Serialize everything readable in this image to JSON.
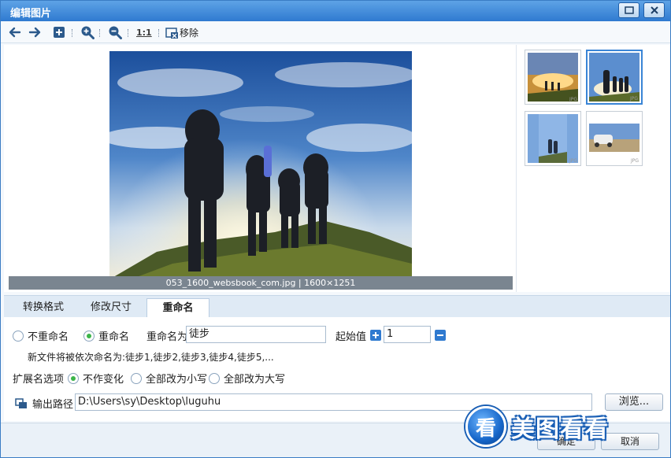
{
  "window": {
    "title": "编辑图片"
  },
  "toolbar": {
    "back_icon": "arrow-left-icon",
    "forward_icon": "arrow-right-icon",
    "add_icon": "plus-square-icon",
    "zoom_in_icon": "zoom-in-icon",
    "zoom_out_icon": "zoom-out-icon",
    "actual_size_label": "1:1",
    "remove_label": "移除"
  },
  "preview": {
    "caption": "053_1600_websbook_com.jpg | 1600×1251"
  },
  "thumbnails": [
    {
      "tag": "JPG",
      "selected": false
    },
    {
      "tag": "JPG",
      "selected": true
    },
    {
      "tag": "JPG",
      "selected": false
    },
    {
      "tag": "JPG",
      "selected": false
    }
  ],
  "tabs": [
    {
      "label": "转换格式",
      "active": false
    },
    {
      "label": "修改尺寸",
      "active": false
    },
    {
      "label": "重命名",
      "active": true
    }
  ],
  "rename": {
    "option_no_rename": "不重命名",
    "option_rename": "重命名",
    "rename_as_label": "重命名为",
    "rename_as_value": "徒步",
    "start_value_label": "起始值",
    "start_value": "1",
    "preview_text": "新文件将被依次命名为:徒步1,徒步2,徒步3,徒步4,徒步5,...",
    "ext_label": "扩展名选项",
    "ext_no_change": "不作变化",
    "ext_lower": "全部改为小写",
    "ext_upper": "全部改为大写",
    "output_path_label": "输出路径",
    "output_path_value": "D:\\Users\\sy\\Desktop\\luguhu",
    "browse_label": "浏览..."
  },
  "footer": {
    "ok_label": "确定",
    "cancel_label": "取消"
  },
  "watermark": {
    "icon_char": "看",
    "text": "美图看看"
  },
  "colors": {
    "accent": "#2f7ad0",
    "radio_on": "#3bb54a",
    "caption_bg": "#7a8590"
  }
}
